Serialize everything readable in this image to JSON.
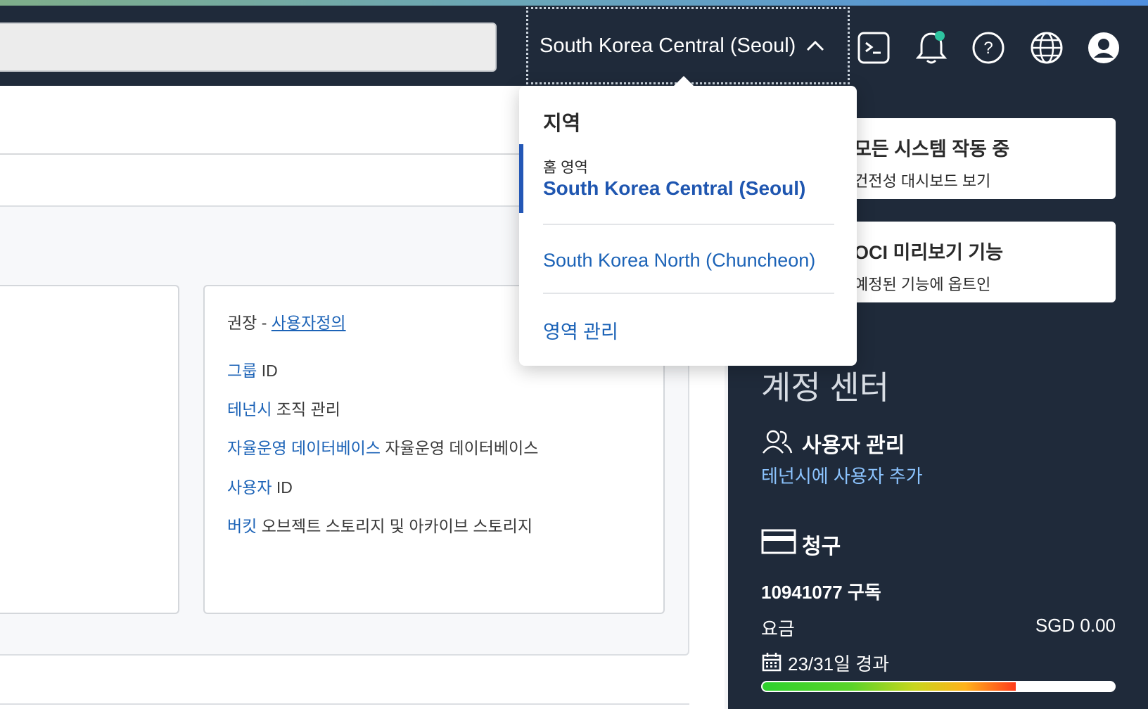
{
  "header": {
    "region_selected": "South Korea Central (Seoul)",
    "icons": [
      "cloud-shell-icon",
      "bell-icon",
      "help-icon",
      "globe-icon",
      "user-avatar-icon"
    ],
    "notification_dot_color": "#2ec4a0"
  },
  "region_dropdown": {
    "heading": "지역",
    "home_label": "홈 영역",
    "home_region": "South Korea Central (Seoul)",
    "other_regions": [
      "South Korea North (Chuncheon)"
    ],
    "manage": "영역 관리"
  },
  "recommended": {
    "prefix": "권장 -",
    "link": "사용자정의",
    "rows": [
      {
        "link": "그룹",
        "text": "ID"
      },
      {
        "link": "테넌시",
        "text": "조직 관리"
      },
      {
        "link": "자율운영 데이터베이스",
        "text": "자율운영 데이터베이스"
      },
      {
        "link": "사용자",
        "text": "ID"
      },
      {
        "link": "버킷",
        "text": "오브젝트 스토리지 및 아카이브 스토리지"
      }
    ]
  },
  "sidebar": {
    "status_cards": [
      {
        "title": "모든 시스템 작동 중",
        "subtitle": "건전성 대시보드 보기"
      },
      {
        "title": "OCI 미리보기 기능",
        "subtitle": "예정된 기능에 옵트인"
      }
    ],
    "account_center_title": "계정 센터",
    "user_mgmt": {
      "title": "사용자 관리",
      "link": "테넌시에 사용자 추가"
    },
    "billing": {
      "title": "청구",
      "subscription": "10941077 구독",
      "charges_label": "요금",
      "charges_value": "SGD 0.00",
      "days_elapsed": "23/31일 경과",
      "progress_fraction": 0.72
    }
  }
}
